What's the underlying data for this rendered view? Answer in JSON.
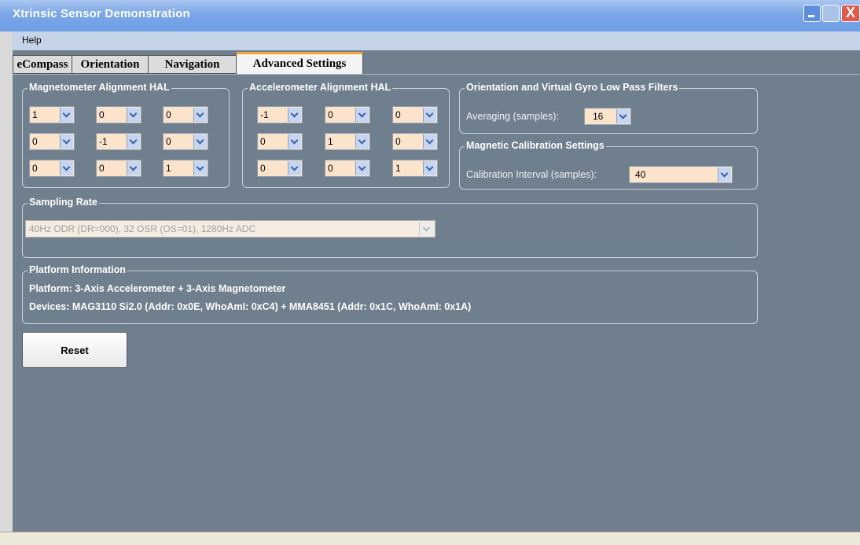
{
  "window": {
    "title": "Xtrinsic Sensor Demonstration",
    "close_glyph": "X"
  },
  "menu": {
    "help": "Help"
  },
  "tabs": [
    {
      "label": "eCompass",
      "active": false
    },
    {
      "label": "Orientation",
      "active": false
    },
    {
      "label": "Navigation",
      "active": false
    },
    {
      "label": "Advanced Settings",
      "active": true
    }
  ],
  "magnetometer_hal": {
    "title": "Magnetometer Alignment HAL",
    "values": [
      [
        "1",
        "0",
        "0"
      ],
      [
        "0",
        "-1",
        "0"
      ],
      [
        "0",
        "0",
        "1"
      ]
    ]
  },
  "accelerometer_hal": {
    "title": "Accelerometer Alignment HAL",
    "values": [
      [
        "-1",
        "0",
        "0"
      ],
      [
        "0",
        "1",
        "0"
      ],
      [
        "0",
        "0",
        "1"
      ]
    ]
  },
  "lowpass": {
    "title": "Orientation and Virtual Gyro Low Pass Filters",
    "averaging_label": "Averaging (samples):",
    "averaging_value": "16"
  },
  "mag_calibration": {
    "title": "Magnetic Calibration Settings",
    "interval_label": "Calibration Interval (samples):",
    "interval_value": "40"
  },
  "sampling_rate": {
    "title": "Sampling Rate",
    "value": "40Hz ODR (DR=000), 32 OSR (OS=01), 1280Hz ADC"
  },
  "platform_info": {
    "title": "Platform Information",
    "platform": "Platform: 3-Axis Accelerometer + 3-Axis Magnetometer",
    "devices": "Devices: MAG3110 Si2.0  (Addr: 0x0E, WhoAmI: 0xC4) +  MMA8451 (Addr: 0x1C, WhoAmI: 0x1A)"
  },
  "reset_label": "Reset",
  "colors": {
    "background": "#6f7f8d",
    "titlebar": "#7aa7e8",
    "select_bg": "#fbe3cc",
    "active_tab_accent": "#f3a33a"
  }
}
